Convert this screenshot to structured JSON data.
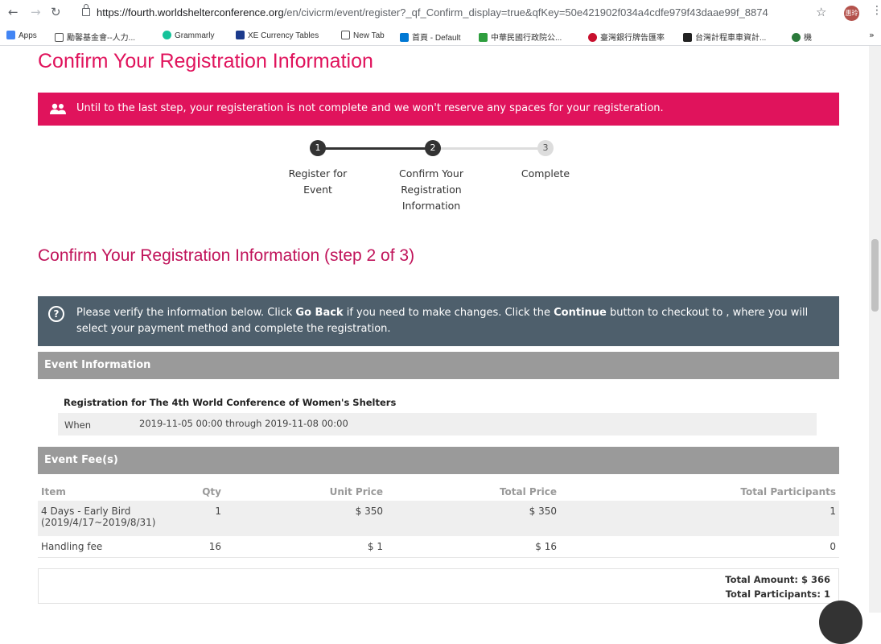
{
  "browser": {
    "url_host": "https://fourth.worldshelterconference.org",
    "url_path": "/en/civicrm/event/register?_qf_Confirm_display=true&qfKey=50e421902f034a4cdfe979f43daae99f_8874",
    "avatar_text": "惠玲",
    "bookmarks": [
      {
        "label": "Apps",
        "icon": "apps-grid-icon",
        "color": "#4285f4"
      },
      {
        "label": "勵馨基金會--人力...",
        "icon": "page-icon",
        "color": "#ffffff"
      },
      {
        "label": "Grammarly",
        "icon": "grammarly-icon",
        "color": "#15c39a"
      },
      {
        "label": "XE Currency Tables",
        "icon": "xe-icon",
        "color": "#1b3a8c"
      },
      {
        "label": "New Tab",
        "icon": "page-icon",
        "color": "#ffffff"
      },
      {
        "label": "首頁 - Default",
        "icon": "sharepoint-icon",
        "color": "#0078d4"
      },
      {
        "label": "中華民國行政院公...",
        "icon": "gov-icon",
        "color": "#2e9e3e"
      },
      {
        "label": "臺灣銀行牌告匯率",
        "icon": "bank-icon",
        "color": "#c8102e"
      },
      {
        "label": "台灣計程車車資計...",
        "icon": "taxi-icon",
        "color": "#222222"
      },
      {
        "label": "機",
        "icon": "site-icon",
        "color": "#2b7a3b"
      }
    ]
  },
  "page": {
    "title": "Confirm Your Registration Information",
    "warning": "Until to the last step, your registeration is not complete and we won't reserve any spaces for your registeration.",
    "steps": [
      {
        "num": "1",
        "label": "Register for Event"
      },
      {
        "num": "2",
        "label": "Confirm Your Registration Information"
      },
      {
        "num": "3",
        "label": "Complete"
      }
    ],
    "section_title": "Confirm Your Registration Information (step 2 of 3)",
    "info": {
      "pre": "Please verify the information below. Click ",
      "go_back": "Go Back",
      "mid": " if you need to make changes. Click the ",
      "continue": "Continue",
      "post": " button to checkout to , where you will select your payment method and complete the registration."
    },
    "event_info_header": "Event Information",
    "event_name": "Registration for The 4th World Conference of Women's Shelters",
    "when_label": "When",
    "when_value": "2019-11-05 00:00  through  2019-11-08 00:00",
    "fee_header": "Event Fee(s)",
    "fee_columns": {
      "item": "Item",
      "qty": "Qty",
      "unit": "Unit Price",
      "total": "Total Price",
      "participants": "Total Participants"
    },
    "fee_rows": [
      {
        "item_line1": "4 Days - Early Bird",
        "item_line2": "(2019/4/17~2019/8/31)",
        "qty": "1",
        "unit": "$ 350",
        "total": "$ 350",
        "participants": "1"
      },
      {
        "item_line1": "Handling fee",
        "item_line2": "",
        "qty": "16",
        "unit": "$ 1",
        "total": "$ 16",
        "participants": "0"
      }
    ],
    "total_amount": "Total Amount: $ 366",
    "total_participants": "Total Participants: 1"
  },
  "colors": {
    "accent": "#e0135c",
    "info_bg": "#4e5f6c",
    "section_bar": "#9a9a9a"
  }
}
